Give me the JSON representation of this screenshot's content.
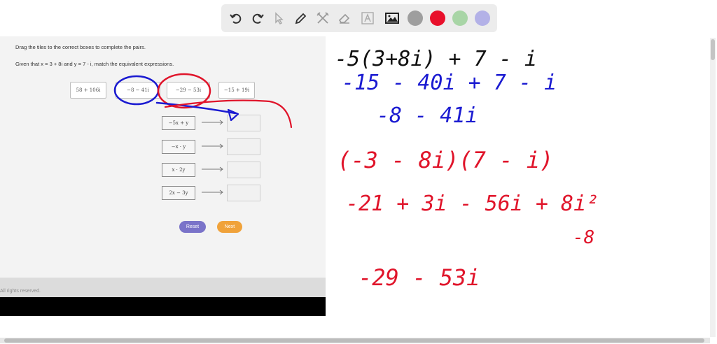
{
  "toolbar": {
    "tools": [
      "undo-icon",
      "redo-icon",
      "pointer-icon",
      "pen-icon",
      "tools-icon",
      "eraser-icon",
      "text-icon",
      "image-icon"
    ],
    "colors": [
      "#9e9e9e",
      "#e8102b",
      "#a8d5a6",
      "#b3b1e7"
    ]
  },
  "question": {
    "instruction": "Drag the tiles to the correct boxes to complete the pairs.",
    "given": "Given that x = 3 + 8i and y = 7 - i, match the equivalent expressions.",
    "tiles": [
      "58 + 106i",
      "−8 − 41i",
      "−29 − 53i",
      "−15 + 19i"
    ],
    "expressions": [
      "−5x + y",
      "−x · y",
      "x · 2y",
      "2x − 3y"
    ],
    "reset_label": "Reset",
    "next_label": "Next",
    "footer": "All rights reserved."
  },
  "handwriting": {
    "lines": [
      "-5(3+8i) + 7 - i",
      "-15 - 40i + 7 - i",
      "-8 - 41i",
      "(-3 - 8i)(7 - i)",
      "-21 + 3i - 56i + 8i²",
      "-8",
      "-29 - 53i"
    ],
    "colors": {
      "black": "#111111",
      "blue": "#1a1ad1",
      "red": "#e0142a"
    }
  }
}
